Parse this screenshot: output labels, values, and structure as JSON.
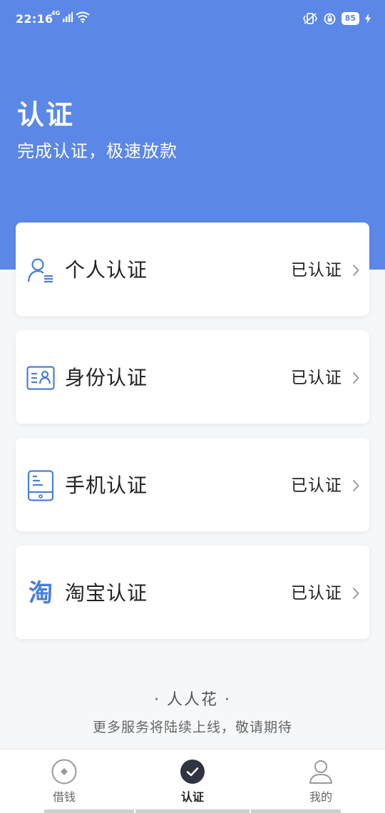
{
  "status_bar": {
    "time": "22:16",
    "battery_level": "85",
    "network_label": "4G"
  },
  "header": {
    "title": "认证",
    "subtitle": "完成认证，极速放款",
    "background_color": "#5b87e6"
  },
  "verification_items": [
    {
      "label": "个人认证",
      "status": "已认证",
      "icon": "person-card-icon"
    },
    {
      "label": "身份认证",
      "status": "已认证",
      "icon": "id-card-icon"
    },
    {
      "label": "手机认证",
      "status": "已认证",
      "icon": "phone-icon"
    },
    {
      "label": "淘宝认证",
      "status": "已认证",
      "icon": "taobao-icon",
      "icon_glyph": "淘"
    }
  ],
  "footer": {
    "brand": "· 人人花 ·",
    "note": "更多服务将陆续上线，敬请期待"
  },
  "tabbar": {
    "tabs": [
      {
        "label": "借钱",
        "icon": "coin-icon",
        "active": false
      },
      {
        "label": "认证",
        "icon": "check-circle-icon",
        "active": true
      },
      {
        "label": "我的",
        "icon": "user-icon",
        "active": false
      }
    ]
  },
  "colors": {
    "accent": "#5b87e6",
    "icon_blue": "#4a7fd8",
    "active_tab": "#2f3342"
  }
}
